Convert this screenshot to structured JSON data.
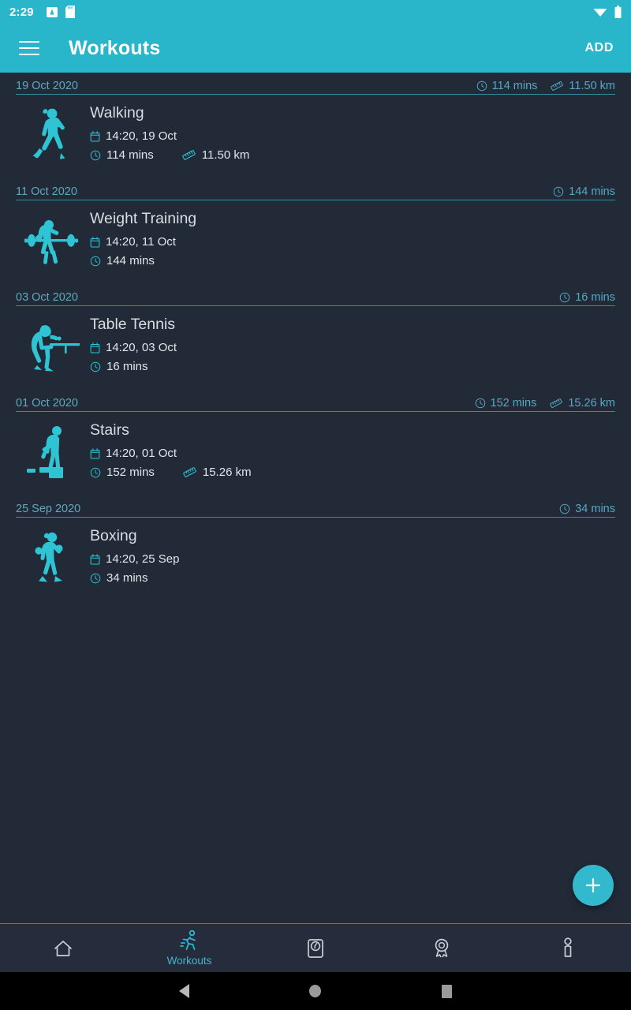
{
  "status_bar": {
    "time": "2:29",
    "left_icons": [
      "app-notification-icon",
      "sd-card-icon"
    ],
    "right_icons": [
      "wifi-icon",
      "battery-icon"
    ],
    "background": "#29b6ca"
  },
  "app_bar": {
    "menu_icon": "hamburger-menu-icon",
    "title": "Workouts",
    "add_label": "ADD",
    "background": "#29b6ca"
  },
  "theme": {
    "accent": "#29b6ca",
    "page_background": "#222a38",
    "divider": "#2d8fa0",
    "header_text": "#5fa8bd",
    "body_text": "#e2e6ea",
    "title_text": "#d8dde3"
  },
  "groups": [
    {
      "date": "19 Oct 2020",
      "summary": {
        "duration": "114 mins",
        "distance": "11.50 km"
      },
      "workout": {
        "icon": "walking-icon",
        "name": "Walking",
        "datetime": "14:20, 19 Oct",
        "duration": "114 mins",
        "distance": "11.50 km"
      }
    },
    {
      "date": "11 Oct 2020",
      "summary": {
        "duration": "144 mins",
        "distance": null
      },
      "workout": {
        "icon": "weight-training-icon",
        "name": "Weight Training",
        "datetime": "14:20, 11 Oct",
        "duration": "144 mins",
        "distance": null
      }
    },
    {
      "date": "03 Oct 2020",
      "summary": {
        "duration": "16 mins",
        "distance": null
      },
      "workout": {
        "icon": "table-tennis-icon",
        "name": "Table Tennis",
        "datetime": "14:20, 03 Oct",
        "duration": "16 mins",
        "distance": null
      }
    },
    {
      "date": "01 Oct 2020",
      "summary": {
        "duration": "152 mins",
        "distance": "15.26 km"
      },
      "workout": {
        "icon": "stairs-icon",
        "name": "Stairs",
        "datetime": "14:20, 01 Oct",
        "duration": "152 mins",
        "distance": "15.26 km"
      }
    },
    {
      "date": "25 Sep 2020",
      "summary": {
        "duration": "34 mins",
        "distance": null
      },
      "workout": {
        "icon": "boxing-icon",
        "name": "Boxing",
        "datetime": "14:20, 25 Sep",
        "duration": "34 mins",
        "distance": null
      }
    }
  ],
  "fab": {
    "icon": "plus-icon",
    "color": "#32b9cd"
  },
  "bottom_nav": {
    "items": [
      {
        "icon": "home-icon",
        "label": "",
        "active": false
      },
      {
        "icon": "running-icon",
        "label": "Workouts",
        "active": true
      },
      {
        "icon": "weight-scale-icon",
        "label": "",
        "active": false
      },
      {
        "icon": "award-medal-icon",
        "label": "",
        "active": false
      },
      {
        "icon": "profile-person-icon",
        "label": "",
        "active": false
      }
    ]
  },
  "system_nav": {
    "back": "back-triangle-icon",
    "home": "home-circle-icon",
    "recents": "recents-square-icon"
  }
}
